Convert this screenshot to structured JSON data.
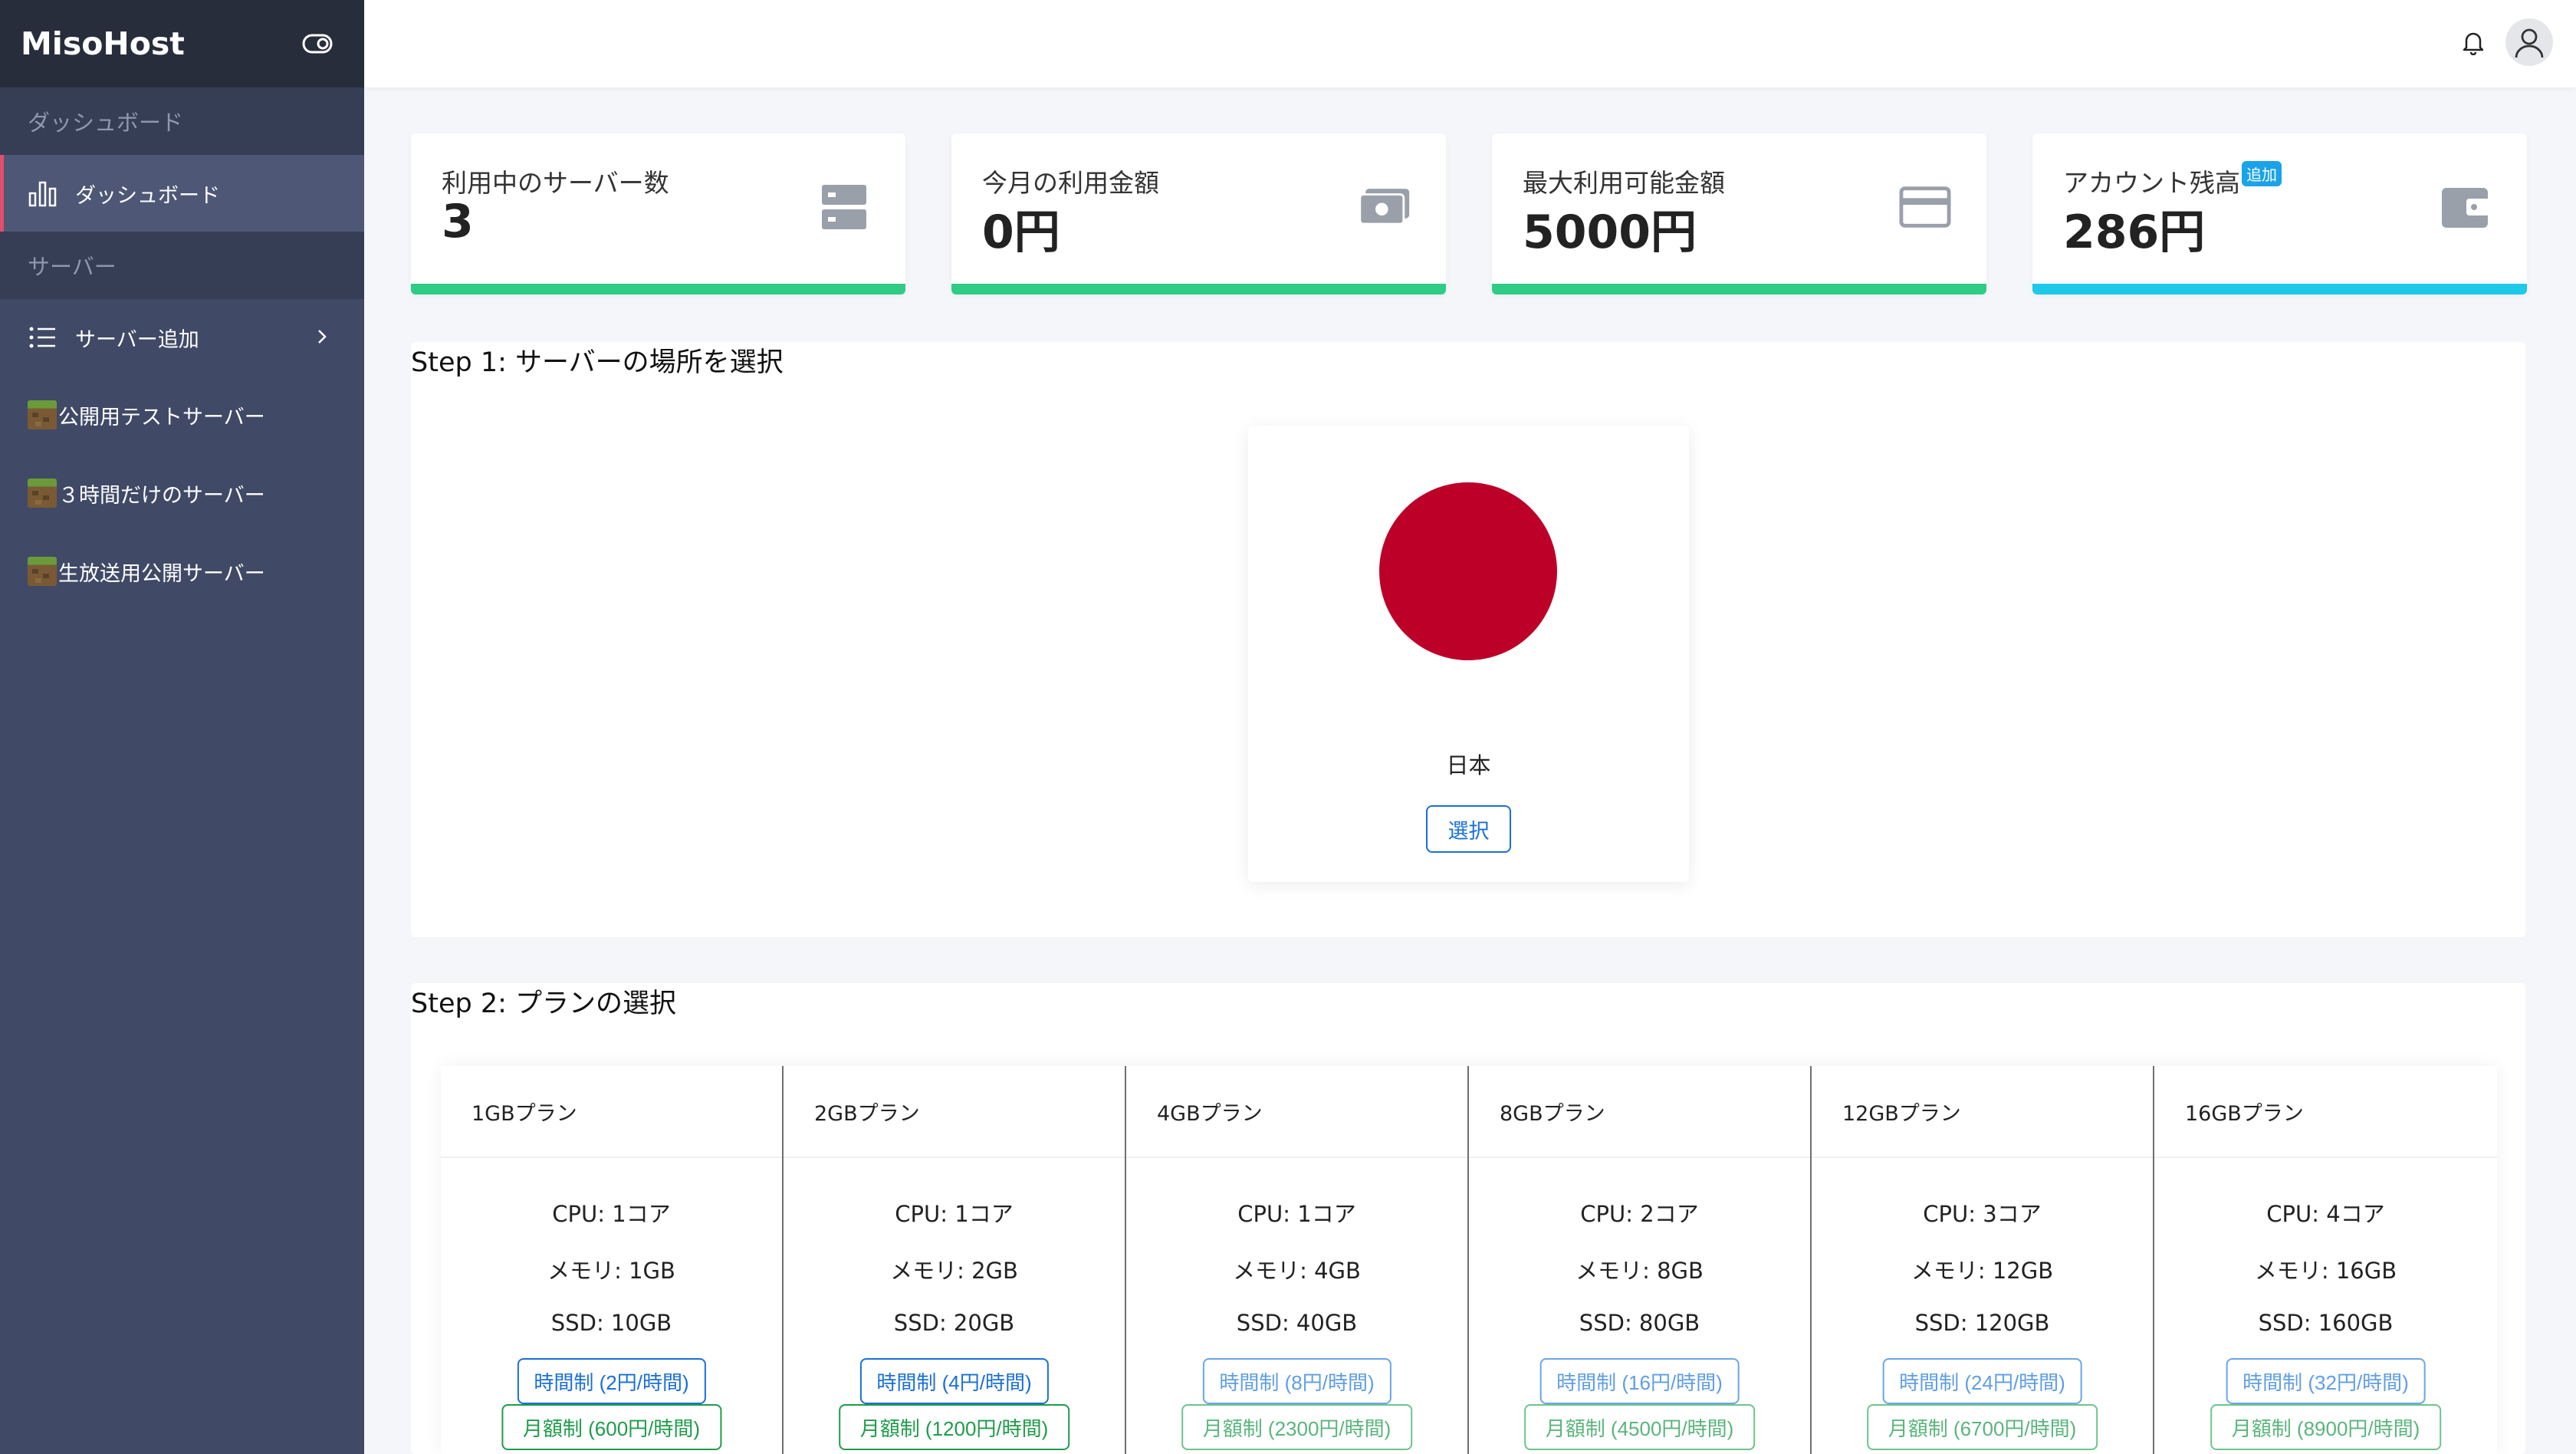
{
  "sidebar": {
    "brand": "MisoHost",
    "section_dashboard": "ダッシュボード",
    "item_dashboard": "ダッシュボード",
    "section_server": "サーバー",
    "item_add_server": "サーバー追加",
    "servers": [
      "公開用テストサーバー",
      "３時間だけのサーバー",
      "生放送用公開サーバー"
    ]
  },
  "stats": [
    {
      "label": "利用中のサーバー数",
      "value": "3",
      "color": "#2ecc85",
      "icon": "server-icon"
    },
    {
      "label": "今月の利用金額",
      "value": "0円",
      "color": "#2ecc85",
      "icon": "money-icon"
    },
    {
      "label": "最大利用可能金額",
      "value": "5000円",
      "color": "#2ecc85",
      "icon": "credit-card-icon"
    },
    {
      "label": "アカウント残高",
      "badge": "追加",
      "value": "286円",
      "color": "#1ec8e8",
      "icon": "wallet-icon"
    }
  ],
  "step1": {
    "title": "Step 1: サーバーの場所を選択",
    "country": "日本",
    "flag_color": "#bc0027",
    "select_label": "選択"
  },
  "step2": {
    "title": "Step 2: プランの選択",
    "plans": [
      {
        "name": "1GBプラン",
        "cpu": "CPU: 1コア",
        "mem": "メモリ: 1GB",
        "ssd": "SSD: 10GB",
        "hourly": "時間制 (2円/時間)",
        "monthly": "月額制 (600円/時間)"
      },
      {
        "name": "2GBプラン",
        "cpu": "CPU: 1コア",
        "mem": "メモリ: 2GB",
        "ssd": "SSD: 20GB",
        "hourly": "時間制 (4円/時間)",
        "monthly": "月額制 (1200円/時間)"
      },
      {
        "name": "4GBプラン",
        "cpu": "CPU: 1コア",
        "mem": "メモリ: 4GB",
        "ssd": "SSD: 40GB",
        "hourly": "時間制 (8円/時間)",
        "monthly": "月額制 (2300円/時間)"
      },
      {
        "name": "8GBプラン",
        "cpu": "CPU: 2コア",
        "mem": "メモリ: 8GB",
        "ssd": "SSD: 80GB",
        "hourly": "時間制 (16円/時間)",
        "monthly": "月額制 (4500円/時間)"
      },
      {
        "name": "12GBプラン",
        "cpu": "CPU: 3コア",
        "mem": "メモリ: 12GB",
        "ssd": "SSD: 120GB",
        "hourly": "時間制 (24円/時間)",
        "monthly": "月額制 (6700円/時間)"
      },
      {
        "name": "16GBプラン",
        "cpu": "CPU: 4コア",
        "mem": "メモリ: 16GB",
        "ssd": "SSD: 160GB",
        "hourly": "時間制 (32円/時間)",
        "monthly": "月額制 (8900円/時間)"
      }
    ]
  }
}
